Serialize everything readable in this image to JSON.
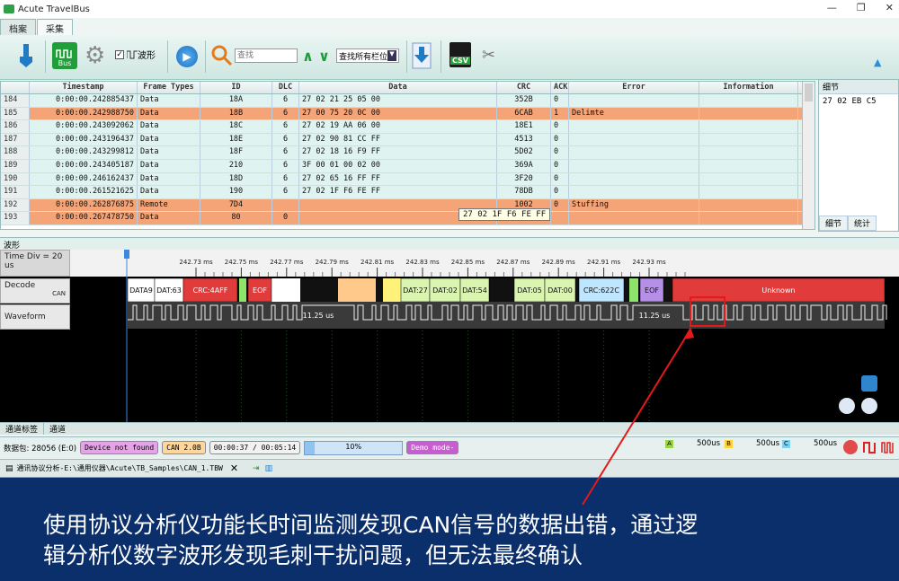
{
  "window": {
    "title": "Acute TravelBus"
  },
  "tabs": [
    {
      "label": "档案"
    },
    {
      "label": "采集"
    }
  ],
  "toolbar": {
    "waveform_label": "波形",
    "search_placeholder": "查找",
    "search_scope": "查找所有栏位",
    "bus_label": "Bus",
    "csv_label": "CSV"
  },
  "table": {
    "columns": [
      "",
      "Timestamp",
      "Frame Types",
      "ID",
      "DLC",
      "Data",
      "CRC",
      "ACK",
      "Error",
      "Information"
    ],
    "rows": [
      {
        "n": "184",
        "ts": "0:00:00.242885437",
        "ft": "Data",
        "id": "18A",
        "dlc": "6",
        "data": "27 02 21 25 05 00",
        "crc": "352B",
        "ack": "0",
        "err": "",
        "info": "",
        "hl": false
      },
      {
        "n": "185",
        "ts": "0:00:00.242988750",
        "ft": "Data",
        "id": "18B",
        "dlc": "6",
        "data": "27 00 75 20 0C 00",
        "crc": "6CAB",
        "ack": "1",
        "err": "Delimte",
        "info": "",
        "hl": true
      },
      {
        "n": "186",
        "ts": "0:00:00.243092062",
        "ft": "Data",
        "id": "18C",
        "dlc": "6",
        "data": "27 02 19 AA 06 00",
        "crc": "18E1",
        "ack": "0",
        "err": "",
        "info": "",
        "hl": false
      },
      {
        "n": "187",
        "ts": "0:00:00.243196437",
        "ft": "Data",
        "id": "18E",
        "dlc": "6",
        "data": "27 02 90 81 CC FF",
        "crc": "4513",
        "ack": "0",
        "err": "",
        "info": "",
        "hl": false
      },
      {
        "n": "188",
        "ts": "0:00:00.243299812",
        "ft": "Data",
        "id": "18F",
        "dlc": "6",
        "data": "27 02 18 16 F9 FF",
        "crc": "5D02",
        "ack": "0",
        "err": "",
        "info": "",
        "hl": false
      },
      {
        "n": "189",
        "ts": "0:00:00.243405187",
        "ft": "Data",
        "id": "210",
        "dlc": "6",
        "data": "3F 00 01 00 02 00",
        "crc": "369A",
        "ack": "0",
        "err": "",
        "info": "",
        "hl": false
      },
      {
        "n": "190",
        "ts": "0:00:00.246162437",
        "ft": "Data",
        "id": "18D",
        "dlc": "6",
        "data": "27 02 65 16 FF FF",
        "crc": "3F20",
        "ack": "0",
        "err": "",
        "info": "",
        "hl": false
      },
      {
        "n": "191",
        "ts": "0:00:00.261521625",
        "ft": "Data",
        "id": "190",
        "dlc": "6",
        "data": "27 02 1F F6 FE FF",
        "crc": "78DB",
        "ack": "0",
        "err": "",
        "info": "",
        "hl": false
      },
      {
        "n": "192",
        "ts": "0:00:00.262876875",
        "ft": "Remote",
        "id": "7D4",
        "dlc": "",
        "data": "",
        "crc": "1002",
        "ack": "0",
        "err": "Stuffing",
        "info": "",
        "hl": true
      },
      {
        "n": "193",
        "ts": "0:00:00.267478750",
        "ft": "Data",
        "id": "80",
        "dlc": "0",
        "data": "",
        "crc": "",
        "ack": "",
        "err": "",
        "info": "",
        "hl": true
      }
    ]
  },
  "tooltip": "27 02 1F F6 FE FF",
  "detail": {
    "title": "细节",
    "content": "27 02 EB C5",
    "tab1": "细节",
    "tab2": "统计"
  },
  "wave": {
    "header": "波形",
    "time_div": "Time Div = 20 us",
    "ticks": [
      "242.73 ms",
      "242.75 ms",
      "242.77 ms",
      "242.79 ms",
      "242.81 ms",
      "242.83 ms",
      "242.85 ms",
      "242.87 ms",
      "242.89 ms",
      "242.91 ms",
      "242.93 ms"
    ],
    "decode_label": "Decode",
    "can_label": "CAN",
    "waveform_label": "Waveform",
    "segments": [
      {
        "t": "DATA9",
        "c": "#ffffff"
      },
      {
        "t": "DAT:63",
        "c": "#ffffff"
      },
      {
        "t": "CRC:4AFF",
        "c": "#e23b3b"
      },
      {
        "t": "EOF",
        "c": "#e23b3b"
      },
      {
        "t": "DAT:27",
        "c": "#d9f5b0"
      },
      {
        "t": "DAT:02",
        "c": "#d9f5b0"
      },
      {
        "t": "DAT:54",
        "c": "#d9f5b0"
      },
      {
        "t": "DAT:05",
        "c": "#d9f5b0"
      },
      {
        "t": "DAT:00",
        "c": "#d9f5b0"
      },
      {
        "t": "CRC:622C",
        "c": "#bfe6ff"
      },
      {
        "t": "EOF",
        "c": "#b690e8"
      },
      {
        "t": "Unknown",
        "c": "#e23b3b"
      }
    ],
    "interval1": "11.25 us",
    "interval2": "11.25 us"
  },
  "bottom_tabs": {
    "t1": "通道标签",
    "t2": "通道"
  },
  "status": {
    "count": "数据包: 28056 (E:0)",
    "device": "Device not found",
    "proto": "CAN 2.0B",
    "time": "00:00:37 / 00:05:14",
    "progress_text": "10%",
    "progress": 0.1,
    "demo": "Demo mode-",
    "a_val": "500us",
    "b_val": "500us",
    "c_val": "500us"
  },
  "filebar": {
    "path": "通讯协议分析-E:\\通用仪器\\Acute\\TB_Samples\\CAN_1.TBW"
  },
  "caption": {
    "line1": "使用协议分析仪功能长时间监测发现CAN信号的数据出错，通过逻",
    "line2": "辑分析仪数字波形发现毛刺干扰问题，但无法最终确认"
  },
  "colors": {
    "row": "#dff3f0",
    "row_highlight": "#f4a476",
    "accent": "#e23b3b",
    "background": "#0b2f6b"
  }
}
